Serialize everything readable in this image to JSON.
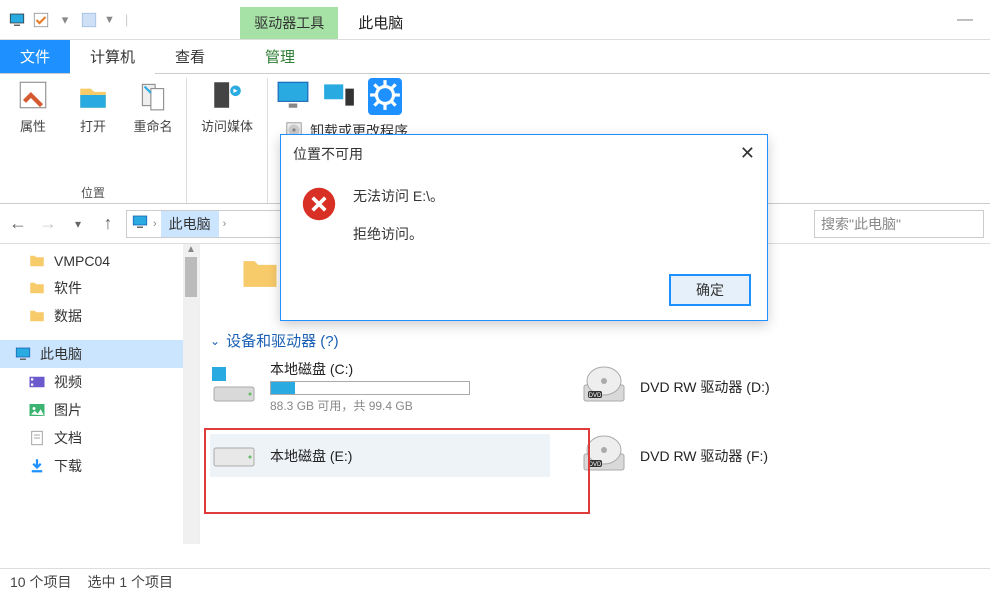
{
  "titlebar": {
    "tool_tab": "驱动器工具",
    "title": "此电脑"
  },
  "tabs": {
    "file": "文件",
    "computer": "计算机",
    "view": "查看",
    "manage": "管理"
  },
  "ribbon": {
    "properties": "属性",
    "open": "打开",
    "rename": "重命名",
    "group_location": "位置",
    "access_media": "访问媒体",
    "uninstall": "卸载或更改程序"
  },
  "nav": {
    "breadcrumb": "此电脑",
    "search_placeholder": "搜索\"此电脑\""
  },
  "tree": {
    "items": [
      {
        "label": "VMPC04"
      },
      {
        "label": "软件"
      },
      {
        "label": "数据"
      }
    ],
    "this_pc": "此电脑",
    "subs": [
      "视频",
      "图片",
      "文档",
      "下载"
    ]
  },
  "main": {
    "section": "设备和驱动器 (?)",
    "drives": [
      {
        "name": "本地磁盘 (C:)",
        "sub": "88.3 GB 可用，共 99.4 GB",
        "fill": 12
      },
      {
        "name": "DVD RW 驱动器 (D:)"
      },
      {
        "name": "本地磁盘 (E:)"
      },
      {
        "name": "DVD RW 驱动器 (F:)"
      }
    ]
  },
  "status": {
    "count": "10 个项目",
    "selected": "选中 1 个项目"
  },
  "dialog": {
    "title": "位置不可用",
    "line1": "无法访问 E:\\。",
    "line2": "拒绝访问。",
    "ok": "确定"
  }
}
